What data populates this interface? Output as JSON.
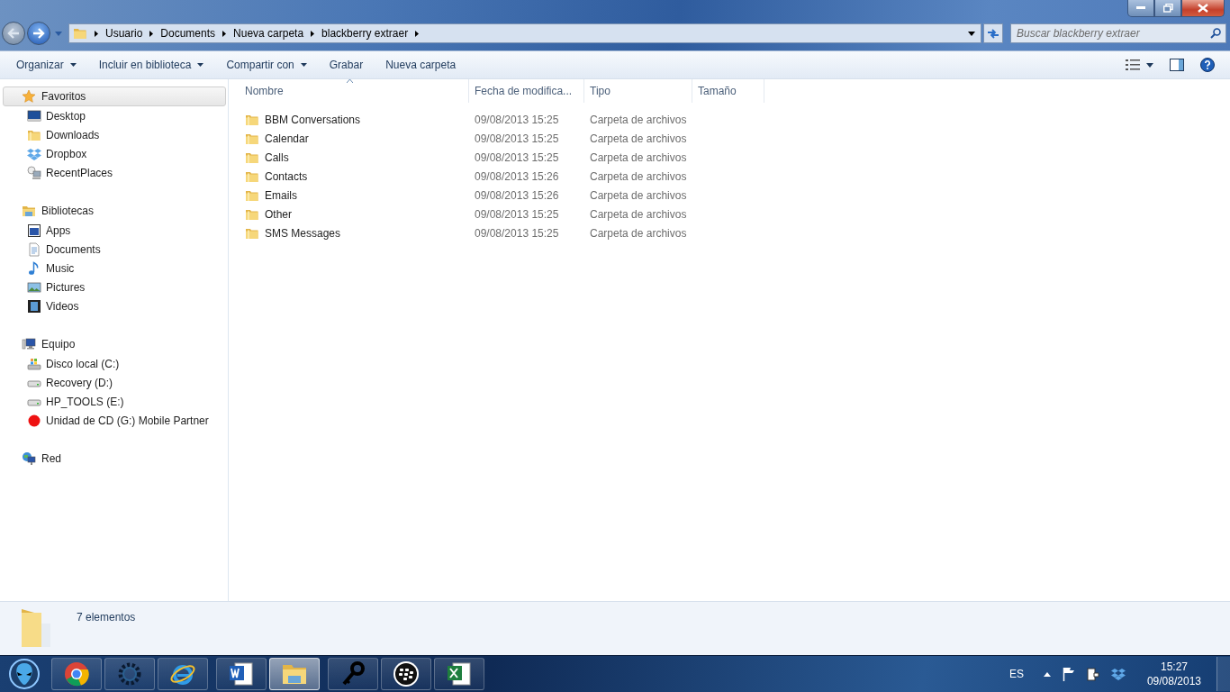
{
  "address_bar": {
    "segments": [
      "Usuario",
      "Documents",
      "Nueva carpeta",
      "blackberry extraer"
    ]
  },
  "search": {
    "placeholder": "Buscar blackberry extraer"
  },
  "toolbar": [
    {
      "label": "Organizar",
      "dropdown": true
    },
    {
      "label": "Incluir en biblioteca",
      "dropdown": true
    },
    {
      "label": "Compartir con",
      "dropdown": true
    },
    {
      "label": "Grabar",
      "dropdown": false
    },
    {
      "label": "Nueva carpeta",
      "dropdown": false
    }
  ],
  "sidebar": {
    "groups": [
      {
        "label": "Favoritos",
        "selected": true,
        "items": [
          {
            "label": "Desktop"
          },
          {
            "label": "Downloads"
          },
          {
            "label": "Dropbox"
          },
          {
            "label": "RecentPlaces"
          }
        ]
      },
      {
        "label": "Bibliotecas",
        "selected": false,
        "items": [
          {
            "label": "Apps"
          },
          {
            "label": "Documents"
          },
          {
            "label": "Music"
          },
          {
            "label": "Pictures"
          },
          {
            "label": "Videos"
          }
        ]
      },
      {
        "label": "Equipo",
        "selected": false,
        "items": [
          {
            "label": "Disco local (C:)"
          },
          {
            "label": "Recovery (D:)"
          },
          {
            "label": "HP_TOOLS (E:)"
          },
          {
            "label": "Unidad de CD (G:) Mobile Partner"
          }
        ]
      },
      {
        "label": "Red",
        "selected": false
      }
    ]
  },
  "table": {
    "columns": [
      {
        "label": "Nombre",
        "sorted": true
      },
      {
        "label": "Fecha de modifica...",
        "sorted": false
      },
      {
        "label": "Tipo",
        "sorted": false
      },
      {
        "label": "Tamaño",
        "sorted": false
      }
    ],
    "rows": [
      {
        "name": "BBM Conversations",
        "date": "09/08/2013 15:25",
        "type": "Carpeta de archivos"
      },
      {
        "name": "Calendar",
        "date": "09/08/2013 15:25",
        "type": "Carpeta de archivos"
      },
      {
        "name": "Calls",
        "date": "09/08/2013 15:25",
        "type": "Carpeta de archivos"
      },
      {
        "name": "Contacts",
        "date": "09/08/2013 15:26",
        "type": "Carpeta de archivos"
      },
      {
        "name": "Emails",
        "date": "09/08/2013 15:26",
        "type": "Carpeta de archivos"
      },
      {
        "name": "Other",
        "date": "09/08/2013 15:25",
        "type": "Carpeta de archivos"
      },
      {
        "name": "SMS Messages",
        "date": "09/08/2013 15:25",
        "type": "Carpeta de archivos"
      }
    ]
  },
  "details_pane": {
    "summary": "7 elementos"
  },
  "taskbar": {
    "buttons": [
      {
        "selected": false
      },
      {
        "selected": false
      },
      {
        "selected": false
      },
      {
        "selected": false
      },
      {
        "selected": true
      },
      {
        "selected": false
      },
      {
        "selected": false
      },
      {
        "selected": false
      }
    ],
    "language": "ES",
    "time": "15:27",
    "date": "09/08/2013"
  }
}
